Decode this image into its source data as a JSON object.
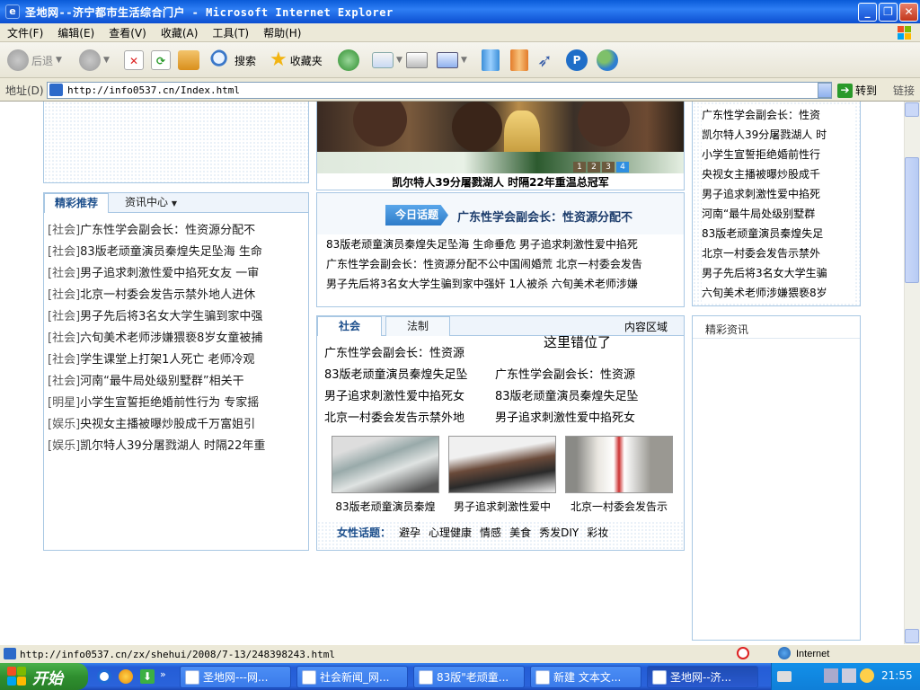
{
  "window": {
    "title": "圣地网--济宁都市生活综合门户 - Microsoft Internet Explorer",
    "icon": "ie-icon"
  },
  "menu": [
    "文件(F)",
    "编辑(E)",
    "查看(V)",
    "收藏(A)",
    "工具(T)",
    "帮助(H)"
  ],
  "toolbar": {
    "back_label": "后退",
    "search_label": "搜索",
    "favorites_label": "收藏夹"
  },
  "address": {
    "label": "地址(D)",
    "url": "http://info0537.cn/Index.html",
    "go_label": "转到",
    "links_label": "链接"
  },
  "left_panel": {
    "tab_active": "精彩推荐",
    "tab_inactive": "资讯中心",
    "items": [
      {
        "cat": "[社会]",
        "title": "广东性学会副会长：性资源分配不"
      },
      {
        "cat": "[社会]",
        "title": "83版老顽童演员秦煌失足坠海 生命"
      },
      {
        "cat": "[社会]",
        "title": "男子追求刺激性爱中掐死女友 一审"
      },
      {
        "cat": "[社会]",
        "title": "北京一村委会发告示禁外地人进休"
      },
      {
        "cat": "[社会]",
        "title": "男子先后将3名女大学生骗到家中强"
      },
      {
        "cat": "[社会]",
        "title": "六旬美术老师涉嫌猥亵8岁女童被捕"
      },
      {
        "cat": "[社会]",
        "title": "学生课堂上打架1人死亡 老师冷观"
      },
      {
        "cat": "[社会]",
        "title": "河南“最牛局处级别墅群”相关干"
      },
      {
        "cat": "[明星]",
        "title": "小学生宣誓拒绝婚前性行为 专家摇"
      },
      {
        "cat": "[娱乐]",
        "title": "央视女主播被曝炒股成千万富姐引"
      },
      {
        "cat": "[娱乐]",
        "title": "凯尔特人39分屠戮湖人 时隔22年重"
      }
    ]
  },
  "slideshow": {
    "caption": "凯尔特人39分屠戮湖人 时隔22年重温总冠军",
    "pager": [
      "1",
      "2",
      "3",
      "4"
    ],
    "active_page": "4"
  },
  "today_topic": {
    "badge": "今日话题",
    "headline": "广东性学会副会长：性资源分配不",
    "lines": [
      "83版老顽童演员秦煌失足坠海  生命垂危  男子追求刺激性爱中掐死",
      "广东性学会副会长：性资源分配不公中国闹婚荒  北京一村委会发告",
      "男子先后将3名女大学生骗到家中强奸  1人被杀  六旬美术老师涉嫌"
    ]
  },
  "society_panel": {
    "tab_active": "社会",
    "tab_inactive": "法制",
    "region_label": "内容区域",
    "annotation": "这里错位了",
    "col1": [
      "广东性学会副会长：性资源",
      "83版老顽童演员秦煌失足坠",
      "男子追求刺激性爱中掐死女",
      "北京一村委会发告示禁外地"
    ],
    "col2": [
      "广东性学会副会长：性资源",
      "83版老顽童演员秦煌失足坠",
      "男子追求刺激性爱中掐死女"
    ],
    "photos": [
      {
        "caption": "83版老顽童演员秦煌"
      },
      {
        "caption": "男子追求刺激性爱中"
      },
      {
        "caption": "北京一村委会发告示"
      }
    ],
    "women_label": "女性话题：",
    "women_topics": [
      "避孕",
      "心理健康",
      "情感",
      "美食",
      "秀发DIY",
      "彩妆"
    ]
  },
  "right_panel": {
    "items": [
      "广东性学会副会长：性资",
      "凯尔特人39分屠戮湖人 时",
      "小学生宣誓拒绝婚前性行",
      "央视女主播被曝炒股成千",
      "男子追求刺激性爱中掐死",
      "河南“最牛局处级别墅群",
      "83版老顽童演员秦煌失足",
      "北京一村委会发告示禁外",
      "男子先后将3名女大学生骗",
      "六旬美术老师涉嫌猥亵8岁"
    ],
    "section2_title": "精彩资讯"
  },
  "statusbar": {
    "url": "http://info0537.cn/zx/shehui/2008/7-13/248398243.html",
    "zone": "Internet"
  },
  "taskbar": {
    "start_label": "开始",
    "tasks": [
      {
        "label": "圣地网---网..."
      },
      {
        "label": "社会新闻_网..."
      },
      {
        "label": "83版\"老顽童..."
      },
      {
        "label": "新建 文本文..."
      },
      {
        "label": "圣地网--济..."
      }
    ],
    "clock": "21:55"
  },
  "colors": {
    "xp_blue": "#245dd6",
    "panel_border": "#a8c7e3",
    "heading_blue": "#1d4f8c",
    "badge_blue": "#3c8fd8"
  }
}
